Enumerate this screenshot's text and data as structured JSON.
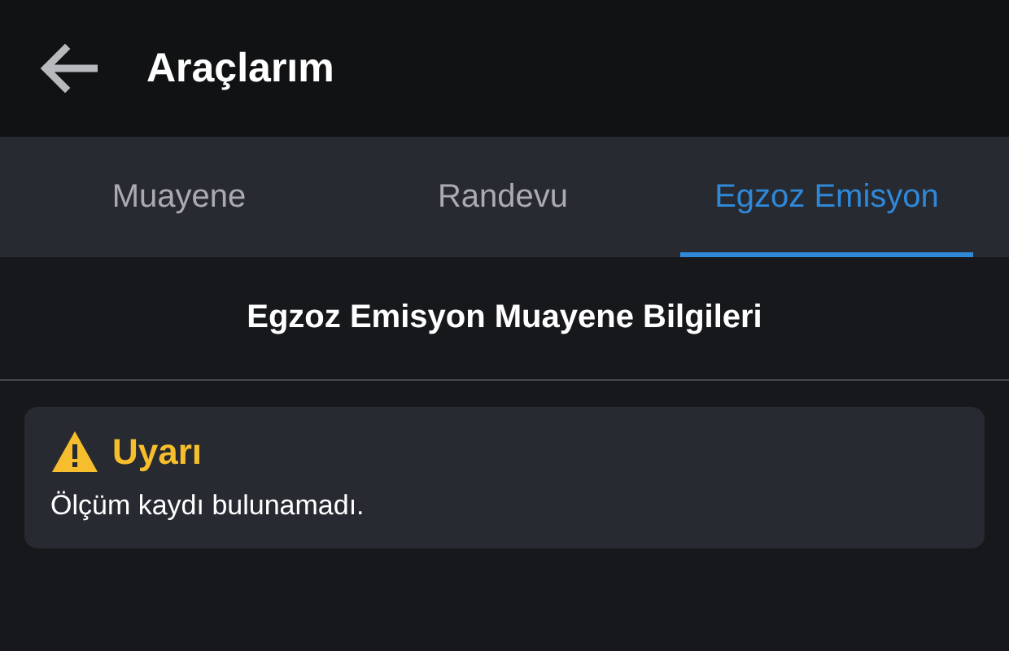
{
  "header": {
    "title": "Araçlarım"
  },
  "tabs": [
    {
      "label": "Muayene",
      "selected": false
    },
    {
      "label": "Randevu",
      "selected": false
    },
    {
      "label": "Egzoz Emisyon",
      "selected": true
    }
  ],
  "section": {
    "title": "Egzoz Emisyon Muayene Bilgileri"
  },
  "alert": {
    "title": "Uyarı",
    "message": "Ölçüm kaydı bulunamadı."
  }
}
